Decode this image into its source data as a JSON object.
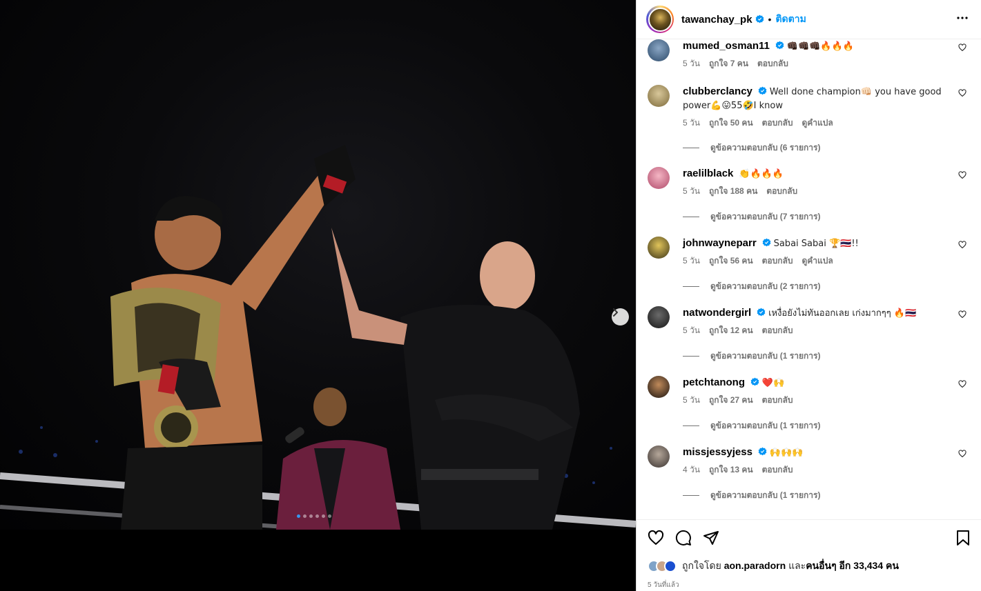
{
  "header": {
    "username": "tawanchay_pk",
    "bullet": "•",
    "follow_label": "ติดตาม"
  },
  "comments": [
    {
      "username": "mumed_osman11",
      "text": "👊🏿👊🏿👊🏿🔥🔥🔥",
      "age": "5 วัน",
      "likes": "ถูกใจ 7 คน",
      "reply": "ตอบกลับ",
      "translate": "",
      "replies": ""
    },
    {
      "username": "clubberclancy",
      "text": "Well done champion👊🏻 you have good power💪😛55🤣I know",
      "age": "5 วัน",
      "likes": "ถูกใจ 50 คน",
      "reply": "ตอบกลับ",
      "translate": "ดูคำแปล",
      "replies": "ดูข้อความตอบกลับ (6 รายการ)"
    },
    {
      "username": "raelilblack",
      "text": "👏🔥🔥🔥",
      "age": "5 วัน",
      "likes": "ถูกใจ 188 คน",
      "reply": "ตอบกลับ",
      "translate": "",
      "replies": "ดูข้อความตอบกลับ (7 รายการ)"
    },
    {
      "username": "johnwayneparr",
      "text": "Sabai Sabai 🏆🇹🇭!!",
      "age": "5 วัน",
      "likes": "ถูกใจ 56 คน",
      "reply": "ตอบกลับ",
      "translate": "ดูคำแปล",
      "replies": "ดูข้อความตอบกลับ (2 รายการ)"
    },
    {
      "username": "natwondergirl",
      "text": "เหงื่อยังไม่ทันออกเลย เก่งมากๆๆ 🔥🇹🇭",
      "age": "5 วัน",
      "likes": "ถูกใจ 12 คน",
      "reply": "ตอบกลับ",
      "translate": "",
      "replies": "ดูข้อความตอบกลับ (1 รายการ)"
    },
    {
      "username": "petchtanong",
      "text": "❤️🙌",
      "age": "5 วัน",
      "likes": "ถูกใจ 27 คน",
      "reply": "ตอบกลับ",
      "translate": "",
      "replies": "ดูข้อความตอบกลับ (1 รายการ)"
    },
    {
      "username": "missjessyjess",
      "text": "🙌🙌🙌",
      "age": "4 วัน",
      "likes": "ถูกใจ 13 คน",
      "reply": "ตอบกลับ",
      "translate": "",
      "replies": "ดูข้อความตอบกลับ (1 รายการ)"
    }
  ],
  "footer": {
    "likes_prefix": "ถูกใจโดย",
    "likes_user": "aon.paradorn",
    "likes_and": "และ",
    "likes_others": "คนอื่นๆ อีก 33,434 คน",
    "time_ago": "5 วันที่แล้ว"
  },
  "carousel": {
    "total": 6,
    "active": 1
  },
  "colors": {
    "accent": "#0095f6",
    "verified": "#0095f6",
    "active_dot": "#3797f0"
  }
}
